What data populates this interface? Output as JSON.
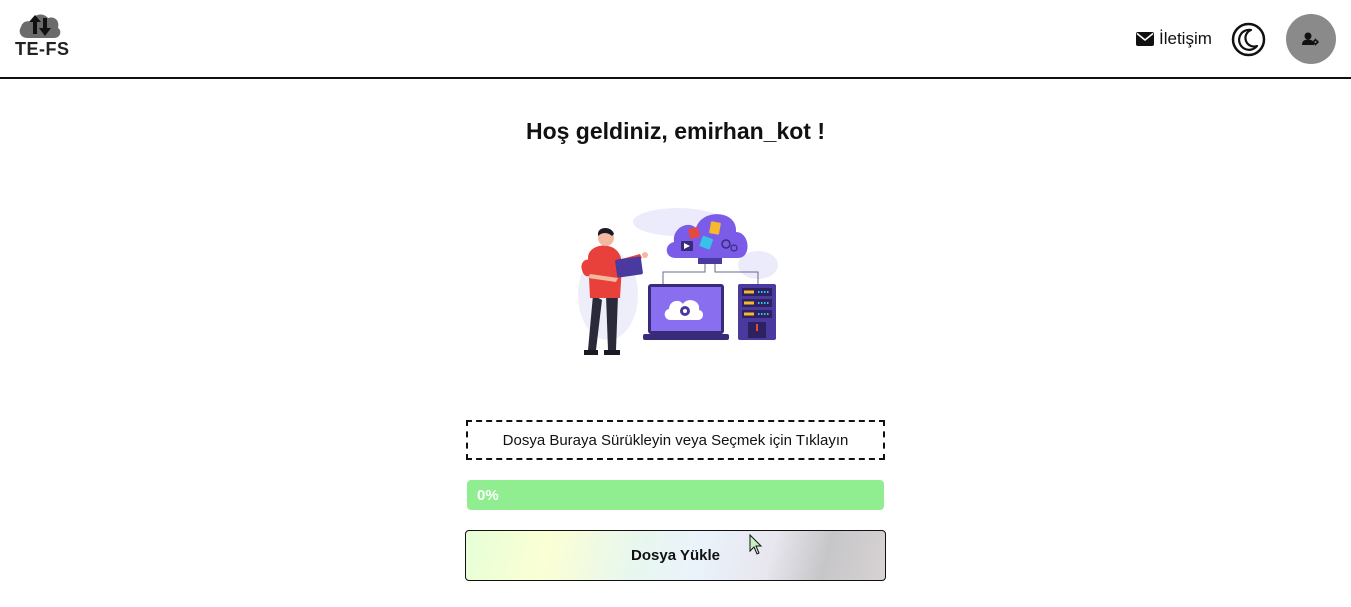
{
  "brand": {
    "name": "TE-FS",
    "icon": "cloud-upload-download-icon"
  },
  "nav": {
    "contact_label": "İletişim",
    "contact_icon": "envelope-icon",
    "theme_icon": "moon-icon",
    "profile_icon": "user-gear-icon"
  },
  "main": {
    "welcome": "Hoş geldiniz, emirhan_kot !",
    "illustration": "cloud-storage-illustration"
  },
  "upload": {
    "dropzone_label": "Dosya Buraya Sürükleyin veya Seçmek için Tıklayın",
    "progress_label": "0%",
    "progress_value": 0,
    "button_label": "Dosya Yükle"
  },
  "colors": {
    "progress_bar": "#90ee90",
    "avatar_bg": "#8a8a8a",
    "accent_purple": "#7b5ce8"
  }
}
